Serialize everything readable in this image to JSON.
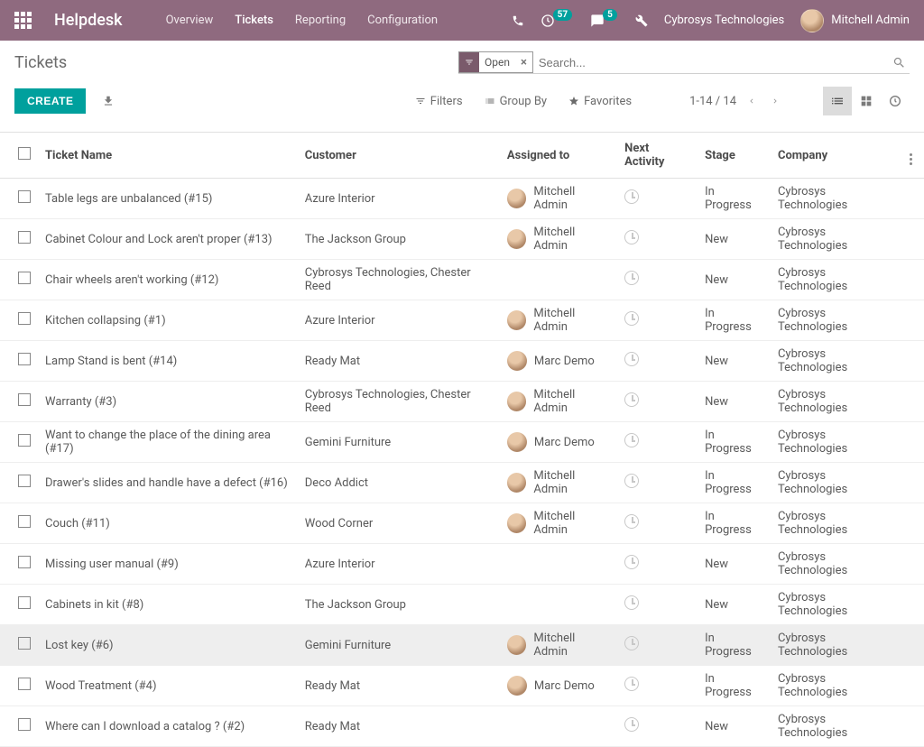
{
  "brand": "Helpdesk",
  "nav": {
    "overview": "Overview",
    "tickets": "Tickets",
    "reporting": "Reporting",
    "configuration": "Configuration"
  },
  "badges": {
    "activities": "57",
    "messages": "5"
  },
  "topbar_company": "Cybrosys Technologies",
  "user_name": "Mitchell Admin",
  "page_title": "Tickets",
  "search": {
    "facet_label": "Open",
    "placeholder": "Search..."
  },
  "toolbar": {
    "create": "CREATE",
    "filters": "Filters",
    "group_by": "Group By",
    "favorites": "Favorites"
  },
  "pager": {
    "range": "1-14 / 14"
  },
  "columns": {
    "name": "Ticket Name",
    "customer": "Customer",
    "assigned": "Assigned to",
    "activity": "Next Activity",
    "stage": "Stage",
    "company": "Company"
  },
  "rows": [
    {
      "name": "Table legs are unbalanced (#15)",
      "customer": "Azure Interior",
      "assigned": "Mitchell Admin",
      "avatar": true,
      "stage": "In Progress",
      "company": "Cybrosys Technologies",
      "selected": false
    },
    {
      "name": "Cabinet Colour and Lock aren't proper (#13)",
      "customer": "The Jackson Group",
      "assigned": "Mitchell Admin",
      "avatar": true,
      "stage": "New",
      "company": "Cybrosys Technologies",
      "selected": false
    },
    {
      "name": "Chair wheels aren't working (#12)",
      "customer": "Cybrosys Technologies, Chester Reed",
      "assigned": "",
      "avatar": false,
      "stage": "New",
      "company": "Cybrosys Technologies",
      "selected": false
    },
    {
      "name": "Kitchen collapsing (#1)",
      "customer": "Azure Interior",
      "assigned": "Mitchell Admin",
      "avatar": true,
      "stage": "In Progress",
      "company": "Cybrosys Technologies",
      "selected": false
    },
    {
      "name": "Lamp Stand is bent (#14)",
      "customer": "Ready Mat",
      "assigned": "Marc Demo",
      "avatar": true,
      "stage": "New",
      "company": "Cybrosys Technologies",
      "selected": false
    },
    {
      "name": "Warranty (#3)",
      "customer": "Cybrosys Technologies, Chester Reed",
      "assigned": "Mitchell Admin",
      "avatar": true,
      "stage": "New",
      "company": "Cybrosys Technologies",
      "selected": false
    },
    {
      "name": "Want to change the place of the dining area (#17)",
      "customer": "Gemini Furniture",
      "assigned": "Marc Demo",
      "avatar": true,
      "stage": "In Progress",
      "company": "Cybrosys Technologies",
      "selected": false
    },
    {
      "name": "Drawer's slides and handle have a defect (#16)",
      "customer": "Deco Addict",
      "assigned": "Mitchell Admin",
      "avatar": true,
      "stage": "In Progress",
      "company": "Cybrosys Technologies",
      "selected": false
    },
    {
      "name": "Couch (#11)",
      "customer": "Wood Corner",
      "assigned": "Mitchell Admin",
      "avatar": true,
      "stage": "In Progress",
      "company": "Cybrosys Technologies",
      "selected": false
    },
    {
      "name": "Missing user manual (#9)",
      "customer": "Azure Interior",
      "assigned": "",
      "avatar": false,
      "stage": "New",
      "company": "Cybrosys Technologies",
      "selected": false
    },
    {
      "name": "Cabinets in kit (#8)",
      "customer": "The Jackson Group",
      "assigned": "",
      "avatar": false,
      "stage": "New",
      "company": "Cybrosys Technologies",
      "selected": false
    },
    {
      "name": "Lost key (#6)",
      "customer": "Gemini Furniture",
      "assigned": "Mitchell Admin",
      "avatar": true,
      "stage": "In Progress",
      "company": "Cybrosys Technologies",
      "selected": true
    },
    {
      "name": "Wood Treatment (#4)",
      "customer": "Ready Mat",
      "assigned": "Marc Demo",
      "avatar": true,
      "stage": "In Progress",
      "company": "Cybrosys Technologies",
      "selected": false
    },
    {
      "name": "Where can I download a catalog ? (#2)",
      "customer": "Ready Mat",
      "assigned": "",
      "avatar": false,
      "stage": "New",
      "company": "Cybrosys Technologies",
      "selected": false
    }
  ]
}
